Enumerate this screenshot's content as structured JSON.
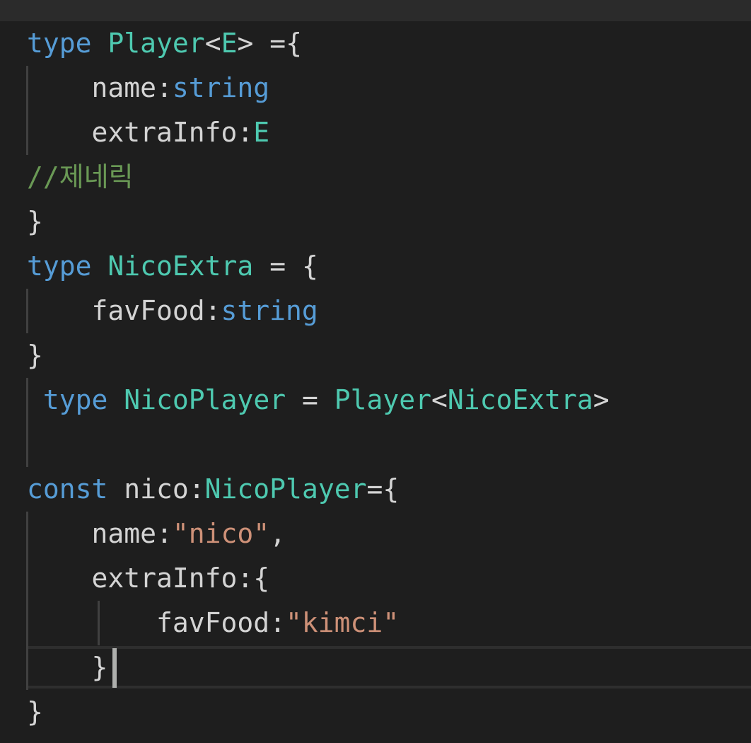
{
  "editor": {
    "lines": [
      [
        {
          "t": "type",
          "c": "kw"
        },
        {
          "t": " ",
          "c": "pn"
        },
        {
          "t": "Player",
          "c": "tp"
        },
        {
          "t": "<",
          "c": "pn"
        },
        {
          "t": "E",
          "c": "tp"
        },
        {
          "t": "> ={",
          "c": "pn"
        }
      ],
      [
        {
          "t": "    name:",
          "c": "pn"
        },
        {
          "t": "string",
          "c": "kw"
        }
      ],
      [
        {
          "t": "    extraInfo:",
          "c": "pn"
        },
        {
          "t": "E",
          "c": "tp"
        }
      ],
      [
        {
          "t": "//제네릭",
          "c": "cm"
        }
      ],
      [
        {
          "t": "}",
          "c": "pn"
        }
      ],
      [
        {
          "t": "type",
          "c": "kw"
        },
        {
          "t": " ",
          "c": "pn"
        },
        {
          "t": "NicoExtra",
          "c": "tp"
        },
        {
          "t": " = {",
          "c": "pn"
        }
      ],
      [
        {
          "t": "    favFood:",
          "c": "pn"
        },
        {
          "t": "string",
          "c": "kw"
        }
      ],
      [
        {
          "t": "}",
          "c": "pn"
        }
      ],
      [
        {
          "t": " ",
          "c": "pn"
        },
        {
          "t": "type",
          "c": "kw"
        },
        {
          "t": " ",
          "c": "pn"
        },
        {
          "t": "NicoPlayer",
          "c": "tp"
        },
        {
          "t": " = ",
          "c": "pn"
        },
        {
          "t": "Player",
          "c": "tp"
        },
        {
          "t": "<",
          "c": "pn"
        },
        {
          "t": "NicoExtra",
          "c": "tp"
        },
        {
          "t": ">",
          "c": "pn"
        }
      ],
      [],
      [
        {
          "t": "const",
          "c": "kw"
        },
        {
          "t": " nico:",
          "c": "pn"
        },
        {
          "t": "NicoPlayer",
          "c": "tp"
        },
        {
          "t": "={",
          "c": "pn"
        }
      ],
      [
        {
          "t": "    name:",
          "c": "pn"
        },
        {
          "t": "\"nico\"",
          "c": "str"
        },
        {
          "t": ",",
          "c": "pn"
        }
      ],
      [
        {
          "t": "    extraInfo:{",
          "c": "pn"
        }
      ],
      [
        {
          "t": "        favFood:",
          "c": "pn"
        },
        {
          "t": "\"kimci\"",
          "c": "str"
        }
      ],
      [
        {
          "t": "    }",
          "c": "pn"
        }
      ],
      [
        {
          "t": "}",
          "c": "pn"
        }
      ]
    ]
  },
  "colors": {
    "keyword": "#569cd6",
    "type": "#4ec9b0",
    "string": "#ce9178",
    "comment": "#6a9955",
    "text": "#d4d4d4",
    "background": "#1e1e1e"
  }
}
